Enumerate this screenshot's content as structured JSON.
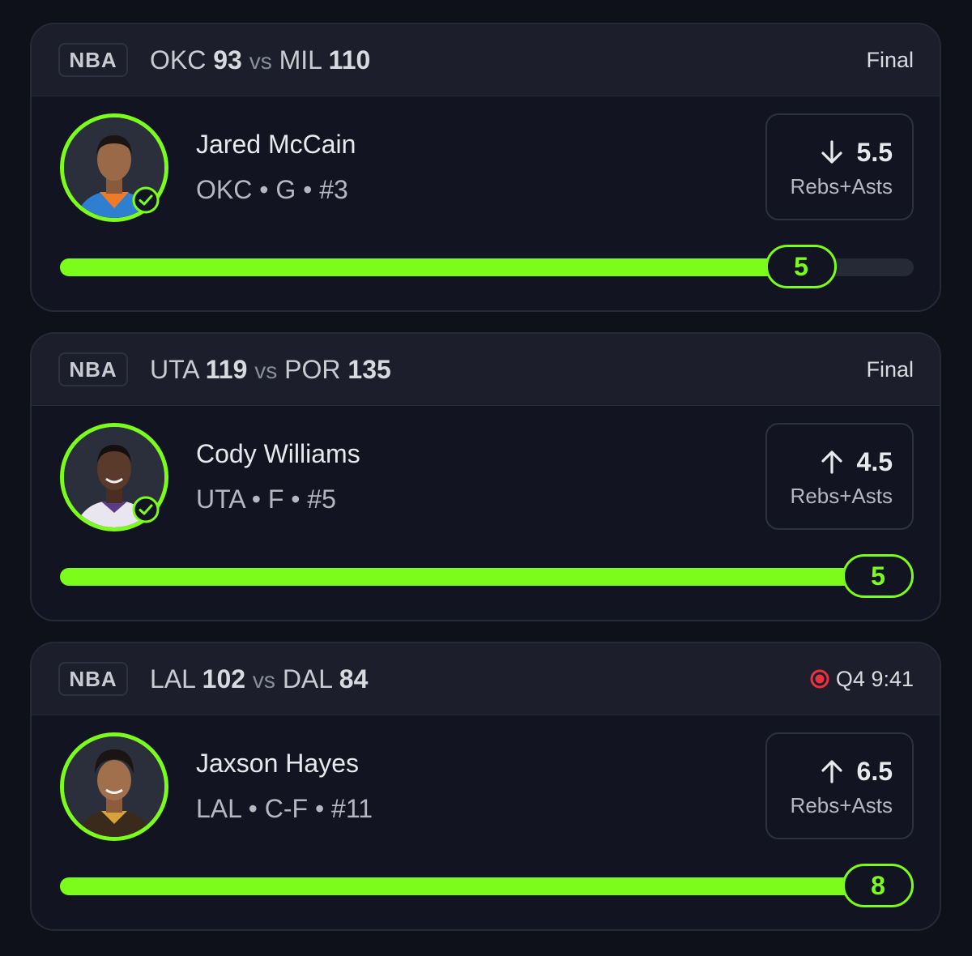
{
  "accent_color": "#7cfc1a",
  "live_color": "#e8333c",
  "cards": [
    {
      "league": "NBA",
      "team1": "OKC",
      "score1": "93",
      "vs": "vs",
      "team2": "MIL",
      "score2": "110",
      "status": "Final",
      "is_live": false,
      "player_name": "Jared McCain",
      "player_meta": "OKC • G • #3",
      "has_check": true,
      "line_direction": "under",
      "line_icon": "arrow-down-icon",
      "line_value": "5.5",
      "line_stat": "Rebs+Asts",
      "result_value": "5",
      "progress_fraction": 0.91
    },
    {
      "league": "NBA",
      "team1": "UTA",
      "score1": "119",
      "vs": "vs",
      "team2": "POR",
      "score2": "135",
      "status": "Final",
      "is_live": false,
      "player_name": "Cody Williams",
      "player_meta": "UTA • F • #5",
      "has_check": true,
      "line_direction": "over",
      "line_icon": "arrow-up-icon",
      "line_value": "4.5",
      "line_stat": "Rebs+Asts",
      "result_value": "5",
      "progress_fraction": 1.0
    },
    {
      "league": "NBA",
      "team1": "LAL",
      "score1": "102",
      "vs": "vs",
      "team2": "DAL",
      "score2": "84",
      "status": "Q4 9:41",
      "is_live": true,
      "player_name": "Jaxson Hayes",
      "player_meta": "LAL • C-F • #11",
      "has_check": false,
      "line_direction": "over",
      "line_icon": "arrow-up-icon",
      "line_value": "6.5",
      "line_stat": "Rebs+Asts",
      "result_value": "8",
      "progress_fraction": 1.0
    }
  ]
}
